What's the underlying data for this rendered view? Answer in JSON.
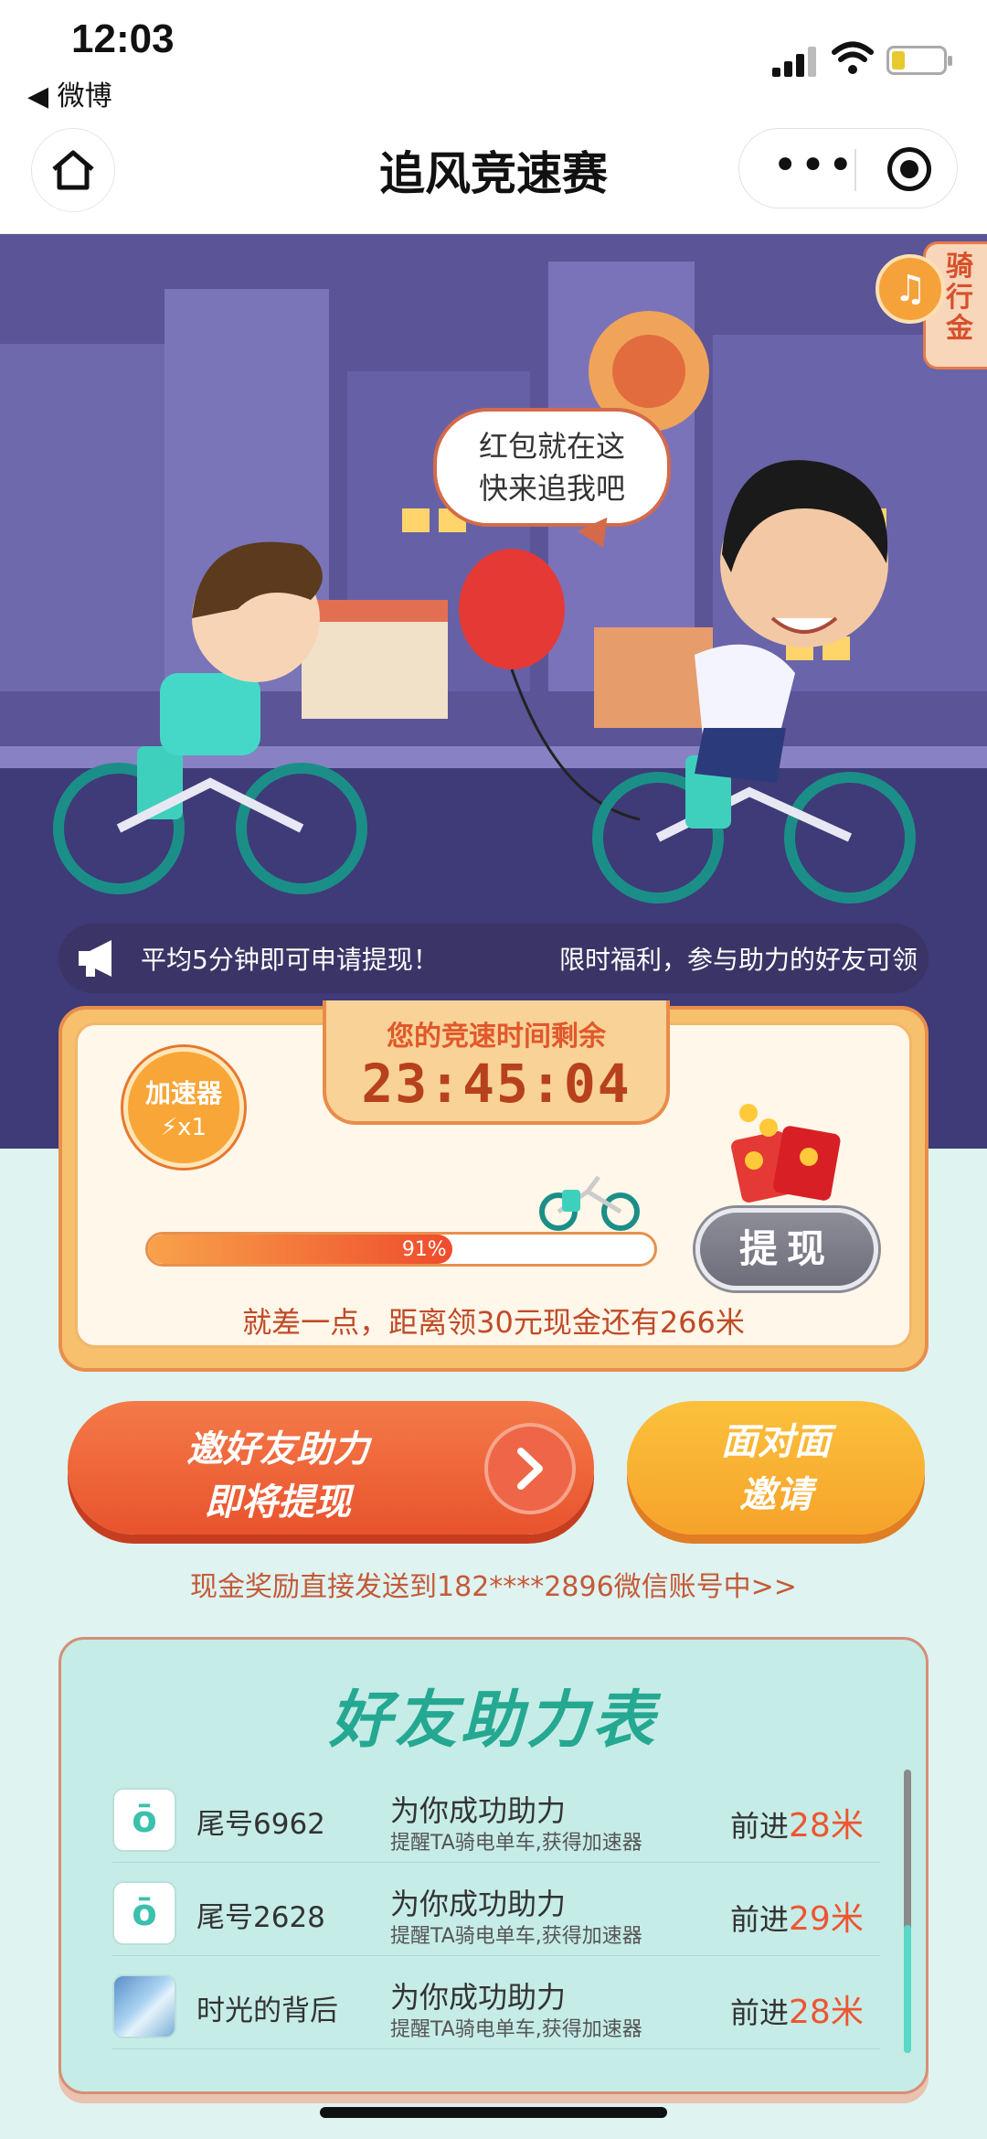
{
  "status_bar": {
    "time": "12:03",
    "back_app": "◀ 微博"
  },
  "nav": {
    "title": "追风竞速赛"
  },
  "hero": {
    "speech_line1": "红包就在这",
    "speech_line2": "快来追我吧",
    "side_tab": "骑行金",
    "marquee_text1": "平均5分钟即可申请提现！",
    "marquee_text2": "限时福利，参与助力的好友可领"
  },
  "panel": {
    "boost_label": "加速器",
    "boost_count": "⚡x1",
    "timer_label": "您的竞速时间剩余",
    "timer_value": "23:45:04",
    "progress_percent": 91,
    "progress_label": "91%",
    "withdraw_label": "提现",
    "remain_text": "就差一点，距离领30元现金还有266米"
  },
  "actions": {
    "invite_line1": "邀好友助力",
    "invite_line2": "即将提现",
    "f2f_line1": "面对面",
    "f2f_line2": "邀请",
    "cash_link": "现金奖励直接发送到182****2896微信账号中>>"
  },
  "friends": {
    "title": "好友助力表",
    "rows": [
      {
        "avatar": "ō",
        "name": "尾号6962",
        "help": "为你成功助力",
        "sub": "提醒TA骑电单车,获得加速器",
        "adv_prefix": "前进",
        "adv_value": "28米"
      },
      {
        "avatar": "ō",
        "name": "尾号2628",
        "help": "为你成功助力",
        "sub": "提醒TA骑电单车,获得加速器",
        "adv_prefix": "前进",
        "adv_value": "29米"
      },
      {
        "avatar": "",
        "name": "时光的背后",
        "help": "为你成功助力",
        "sub": "提醒TA骑电单车,获得加速器",
        "adv_prefix": "前进",
        "adv_value": "28米"
      }
    ]
  },
  "colors": {
    "accent": "#ee5532",
    "teal": "#25a891",
    "hero_bg": "#5b5497"
  }
}
